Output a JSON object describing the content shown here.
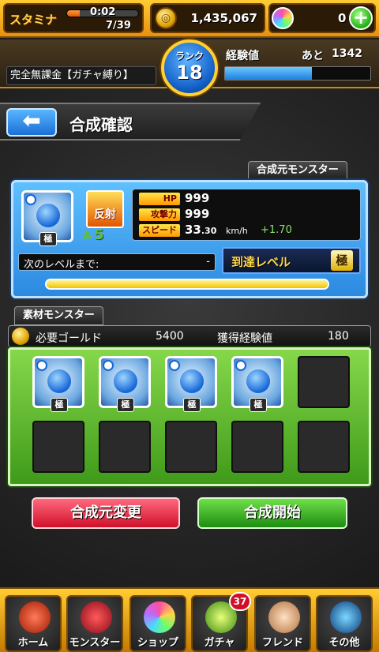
{
  "topbar": {
    "stamina_label": "スタミナ",
    "stamina_timer": "0:02",
    "stamina_count": "7/39",
    "stamina_fraction": 0.18,
    "gold_value": "1,435,067",
    "orb_value": "0"
  },
  "account": {
    "player_name": "完全無課金【ガチャ縛り】",
    "rank_label": "ランク",
    "rank_value": "18",
    "exp_label": "経験値",
    "exp_remaining_label": "あと",
    "exp_remaining_value": "1342",
    "exp_fraction": 0.6
  },
  "header": {
    "title": "合成確認"
  },
  "base_monster": {
    "section_label": "合成元モンスター",
    "ability": "反射",
    "rank_mark": "極",
    "plus_count": "5",
    "stats": [
      {
        "label": "HP",
        "value": "999"
      },
      {
        "label": "攻撃力",
        "value": "999"
      },
      {
        "label": "スピード",
        "value": "33",
        "decimal": ".30",
        "unit": "km/h",
        "bonus": "+1.70"
      }
    ],
    "next_level_label": "次のレベルまで:",
    "next_level_value": "-",
    "reach_level_label": "到達レベル",
    "reach_level_value": "極",
    "level_fraction": 1.0
  },
  "materials": {
    "section_label": "素材モンスター",
    "gold_label": "必要ゴールド",
    "gold_value": "5400",
    "exp_label": "獲得経験値",
    "exp_value": "180",
    "monsters": [
      {
        "rank_mark": "極"
      },
      {
        "rank_mark": "極"
      },
      {
        "rank_mark": "極"
      },
      {
        "rank_mark": "極"
      }
    ]
  },
  "actions": {
    "change_label": "合成元変更",
    "start_label": "合成開始"
  },
  "nav": {
    "items": [
      {
        "label": "ホーム"
      },
      {
        "label": "モンスター"
      },
      {
        "label": "ショップ"
      },
      {
        "label": "ガチャ",
        "badge": "37"
      },
      {
        "label": "フレンド"
      },
      {
        "label": "その他"
      }
    ]
  },
  "colors": {
    "accent_gold": "#ffcc33",
    "panel_blue": "#2b89e0",
    "panel_green": "#3f9a1a",
    "button_red": "#d0102a",
    "button_green": "#1e8c10"
  }
}
